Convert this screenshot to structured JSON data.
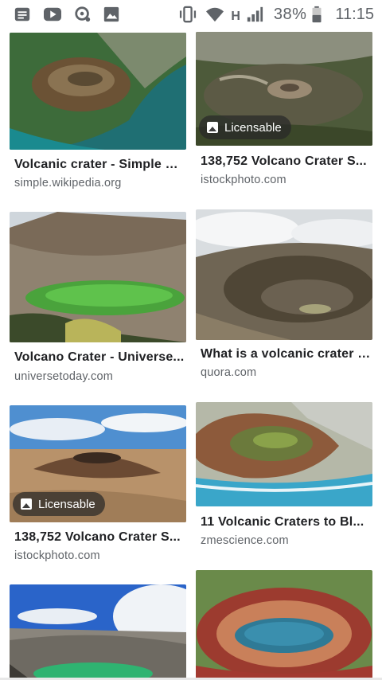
{
  "status_bar": {
    "icons_left": [
      "notes-icon",
      "youtube-icon",
      "assistant-icon",
      "gallery-icon"
    ],
    "icons_right": [
      "vibrate-icon",
      "wifi-icon",
      "signal-icon",
      "battery-icon"
    ],
    "network_type": "H",
    "battery": "38%",
    "time": "11:15"
  },
  "results": [
    {
      "title": "Volcanic crater - Simple E...",
      "source": "simple.wikipedia.org",
      "badge": ""
    },
    {
      "title": "138,752 Volcano Crater S...",
      "source": "istockphoto.com",
      "badge": "Licensable"
    },
    {
      "title": "Volcano Crater - Universe...",
      "source": "universetoday.com",
      "badge": ""
    },
    {
      "title": "What is a volcanic crater I...",
      "source": "quora.com",
      "badge": ""
    },
    {
      "title": "138,752 Volcano Crater S...",
      "source": "istockphoto.com",
      "badge": "Licensable"
    },
    {
      "title": "11 Volcanic Craters to Bl...",
      "source": "zmescience.com",
      "badge": ""
    },
    {
      "title": "",
      "source": "",
      "badge": ""
    },
    {
      "title": "",
      "source": "",
      "badge": ""
    }
  ],
  "colors": {
    "title_text": "#202124",
    "source_text": "#5f6368",
    "badge_bg": "#282828"
  }
}
